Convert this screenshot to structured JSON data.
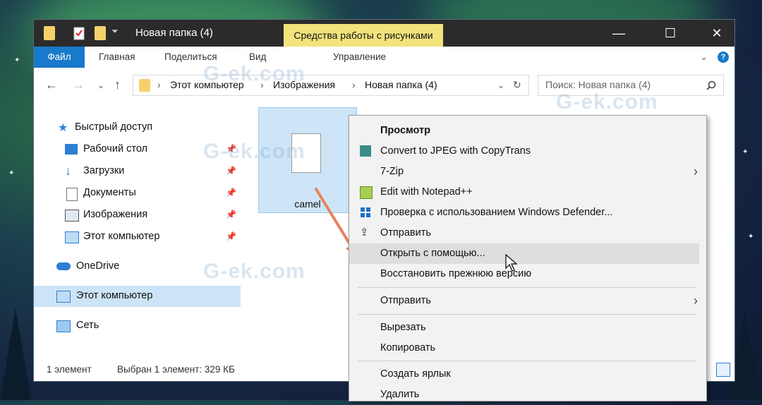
{
  "window": {
    "title": "Новая папка (4)",
    "contextual_tab_group": "Средства работы с рисунками",
    "minimize_icon": "minimize-icon",
    "maximize_icon": "maximize-icon",
    "close_icon": "close-icon"
  },
  "ribbon": {
    "tabs": [
      "Файл",
      "Главная",
      "Поделиться",
      "Вид",
      "Управление"
    ],
    "help_label": "?"
  },
  "navigation": {
    "path": [
      "Этот компьютер",
      "Изображения",
      "Новая папка (4)"
    ],
    "search_placeholder": "Поиск: Новая папка (4)"
  },
  "sidebar": {
    "items": [
      {
        "label": "Быстрый доступ",
        "icon": "star-icon"
      },
      {
        "label": "Рабочий стол",
        "icon": "desktop-icon",
        "pinned": true
      },
      {
        "label": "Загрузки",
        "icon": "download-icon",
        "pinned": true
      },
      {
        "label": "Документы",
        "icon": "documents-icon",
        "pinned": true
      },
      {
        "label": "Изображения",
        "icon": "pictures-icon",
        "pinned": true
      },
      {
        "label": "Этот компьютер",
        "icon": "computer-icon",
        "pinned": true
      },
      {
        "label": "OneDrive",
        "icon": "cloud-icon"
      },
      {
        "label": "Этот компьютер",
        "icon": "computer-icon",
        "selected": true
      },
      {
        "label": "Сеть",
        "icon": "network-icon"
      }
    ]
  },
  "files": [
    {
      "name": "camel",
      "selected": true
    }
  ],
  "status": {
    "count": "1 элемент",
    "selection": "Выбран 1 элемент: 329 КБ"
  },
  "context_menu": {
    "items": [
      {
        "label": "Просмотр",
        "bold": true
      },
      {
        "label": "Convert to JPEG with CopyTrans",
        "icon": "copytrans-icon"
      },
      {
        "label": "7-Zip",
        "submenu": true
      },
      {
        "label": "Edit with Notepad++",
        "icon": "notepad-icon"
      },
      {
        "label": "Проверка с использованием Windows Defender...",
        "icon": "defender-icon"
      },
      {
        "label": "Отправить",
        "icon": "share-icon"
      },
      {
        "label": "Открыть с помощью...",
        "hovered": true
      },
      {
        "label": "Восстановить прежнюю версию"
      },
      {
        "label": "Отправить",
        "submenu": true
      },
      {
        "label": "Вырезать"
      },
      {
        "label": "Копировать"
      },
      {
        "label": "Создать ярлык"
      },
      {
        "label": "Удалить"
      }
    ]
  },
  "watermark": "G-ek.com",
  "colors": {
    "title_bar": "#2b2b2b",
    "accent": "#1979ca",
    "tools_badge": "#f2e37d",
    "selection": "#cde5f7",
    "arrow": "#e8825a"
  }
}
